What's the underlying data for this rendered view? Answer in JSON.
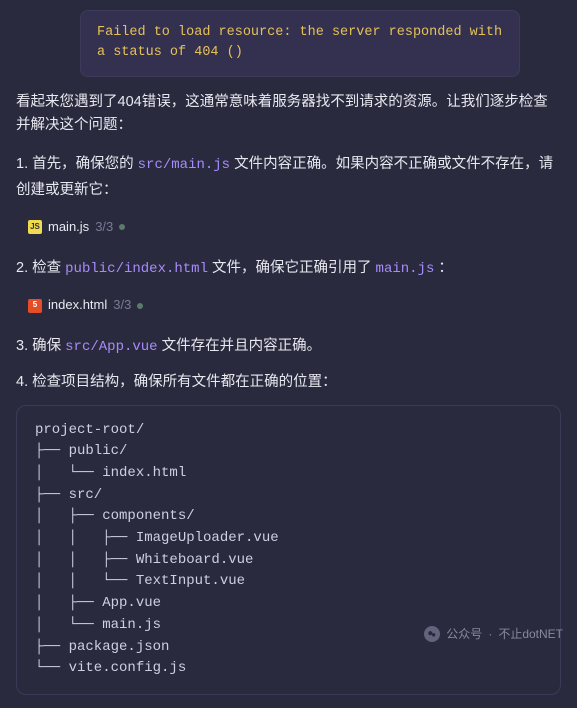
{
  "error": {
    "message": "Failed to load resource: the server responded with a status of 404 ()"
  },
  "intro": "看起来您遇到了404错误，这通常意味着服务器找不到请求的资源。让我们逐步检查并解决这个问题：",
  "steps": {
    "s1_prefix": "1. 首先，确保您的 ",
    "s1_code": "src/main.js",
    "s1_suffix": " 文件内容正确。如果内容不正确或文件不存在，请创建或更新它：",
    "s2_prefix": "2. 检查 ",
    "s2_code": "public/index.html",
    "s2_mid": " 文件，确保它正确引用了 ",
    "s2_code2": "main.js",
    "s2_suffix": " ：",
    "s3_prefix": "3. 确保 ",
    "s3_code": "src/App.vue",
    "s3_suffix": " 文件存在并且内容正确。",
    "s4": "4. 检查项目结构，确保所有文件都在正确的位置："
  },
  "file_chips": {
    "mainjs": {
      "name": "main.js",
      "frac": "3/3"
    },
    "indexhtml": {
      "name": "index.html",
      "frac": "3/3"
    }
  },
  "tree": "project-root/\n├── public/\n│   └── index.html\n├── src/\n│   ├── components/\n│   │   ├── ImageUploader.vue\n│   │   ├── Whiteboard.vue\n│   │   └── TextInput.vue\n│   ├── App.vue\n│   └── main.js\n├── package.json\n└── vite.config.js",
  "watermark": {
    "label": "公众号",
    "name": "不止dotNET"
  }
}
